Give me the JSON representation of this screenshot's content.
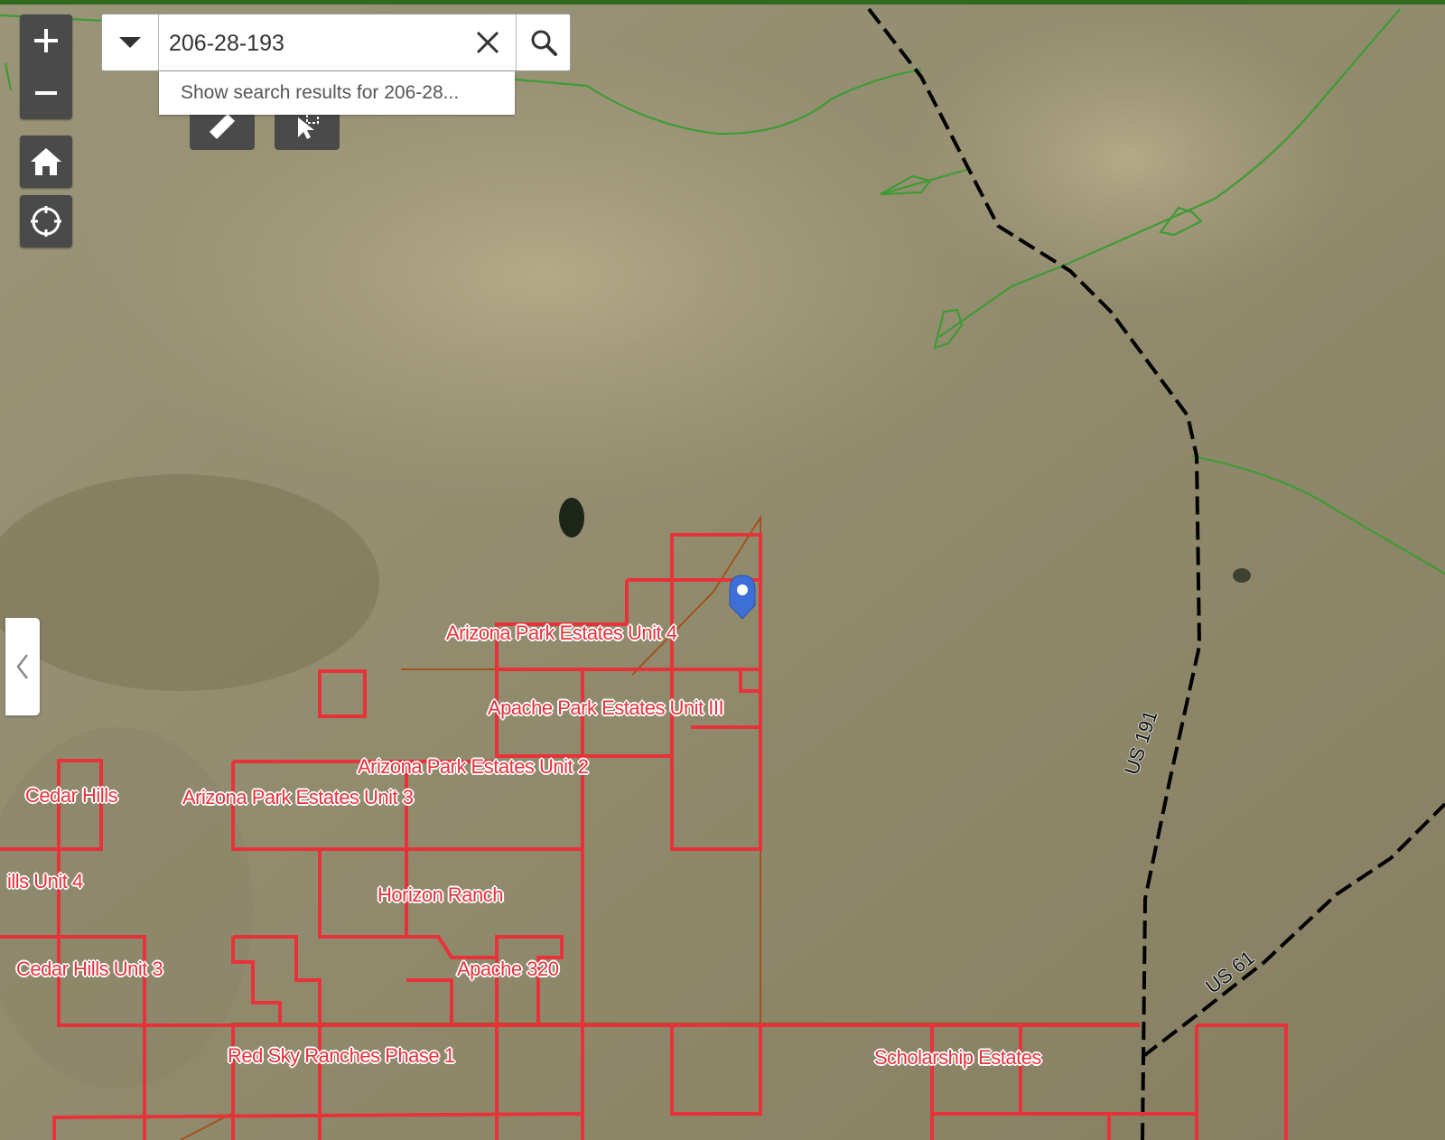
{
  "search": {
    "query": "206-28-193",
    "suggestion": "Show search results for 206-28..."
  },
  "controls": {
    "zoom_in": "+",
    "zoom_out": "−"
  },
  "map_labels": {
    "arizona_park_4": "Arizona Park Estates Unit 4",
    "apache_park_3": "Apache Park Estates Unit III",
    "arizona_park_2": "Arizona Park Estates Unit 2",
    "arizona_park_3": "Arizona Park Estates Unit 3",
    "cedar_hills": "Cedar Hills",
    "hills_unit_4": "ills Unit 4",
    "horizon_ranch": "Horizon Ranch",
    "cedar_hills_3": "Cedar Hills Unit 3",
    "apache_320": "Apache 320",
    "red_sky": "Red Sky Ranches Phase 1",
    "scholarship": "Scholarship Estates"
  },
  "road_labels": {
    "us191": "US 191",
    "us61": "US 61"
  },
  "colors": {
    "top_bar": "#2e6b1f",
    "parcel_red": "#e8323a",
    "boundary_green": "#3f9a34",
    "road_black": "#000000",
    "marker_blue": "#3d6fd6"
  }
}
